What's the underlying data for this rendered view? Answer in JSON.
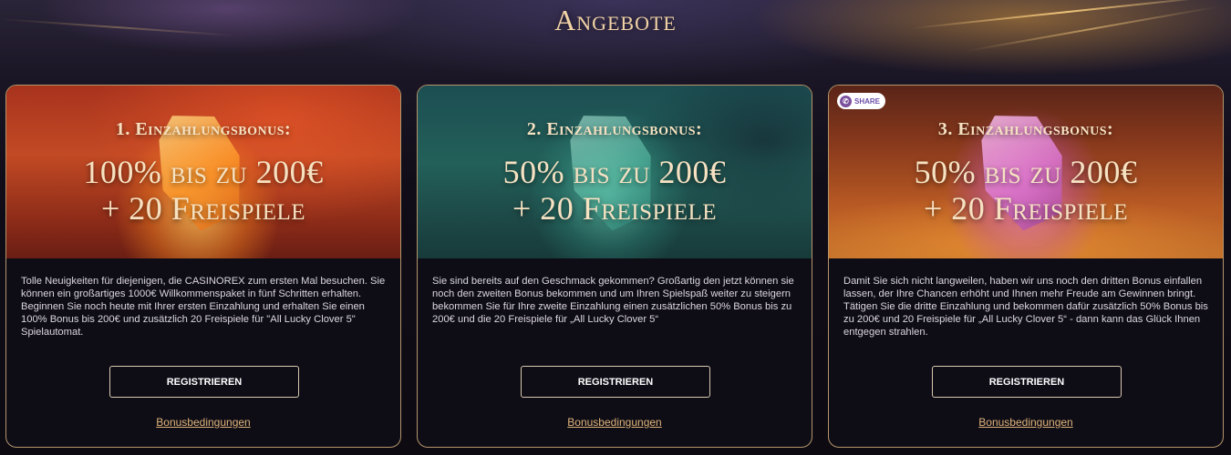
{
  "page": {
    "title": "Angebote"
  },
  "offers": [
    {
      "heading": "1. Einzahlungsbonus:",
      "offer_line1": "100% bis zu 200€",
      "offer_line2": "+ 20 Freispiele",
      "description": "Tolle Neuigkeiten für diejenigen, die CASINOREX zum ersten Mal besuchen. Sie können ein großartiges 1000€ Willkommenspaket in fünf Schritten erhalten. Beginnen Sie noch heute mit Ihrer ersten Einzahlung und erhalten Sie einen 100% Bonus bis 200€ und zusätzlich 20 Freispiele für \"All Lucky Clover 5\" Spielautomat.",
      "register_label": "REGISTRIEREN",
      "terms_label": "Bonusbedingungen",
      "theme_color": "#c24a24"
    },
    {
      "heading": "2. Einzahlungsbonus:",
      "offer_line1": "50% bis zu 200€",
      "offer_line2": "+ 20 Freispiele",
      "description": "Sie sind bereits auf den Geschmack gekommen? Großartig den jetzt können sie noch den zweiten Bonus bekommen und um Ihren Spielspaß weiter zu steigern bekommen Sie für Ihre zweite Einzahlung einen zusätzlichen 50% Bonus bis zu 200€ und die 20 Freispiele für „All Lucky Clover 5“",
      "register_label": "REGISTRIEREN",
      "terms_label": "Bonusbedingungen",
      "theme_color": "#236059"
    },
    {
      "heading": "3. Einzahlungsbonus:",
      "offer_line1": "50% bis zu 200€",
      "offer_line2": "+ 20 Freispiele",
      "description": "Damit Sie sich nicht langweilen, haben wir uns noch den dritten Bonus einfallen lassen, der Ihre Chancen erhöht und Ihnen mehr Freude am Gewinnen bringt. Tätigen Sie die dritte Einzahlung und bekommen dafür zusätzlich 50% Bonus bis zu 200€ und 20 Freispiele für „All Lucky Clover 5“ - dann kann das Glück Ihnen entgegen strahlen.",
      "register_label": "REGISTRIEREN",
      "terms_label": "Bonusbedingungen",
      "theme_color": "#b85a24"
    }
  ],
  "share_badge": {
    "label": "SHARE",
    "icon": "viber-icon"
  },
  "colors": {
    "title": "#f2d3a6",
    "card_border": "#b4956b",
    "link": "#e0b37a",
    "card_background": "#0e0d16"
  }
}
